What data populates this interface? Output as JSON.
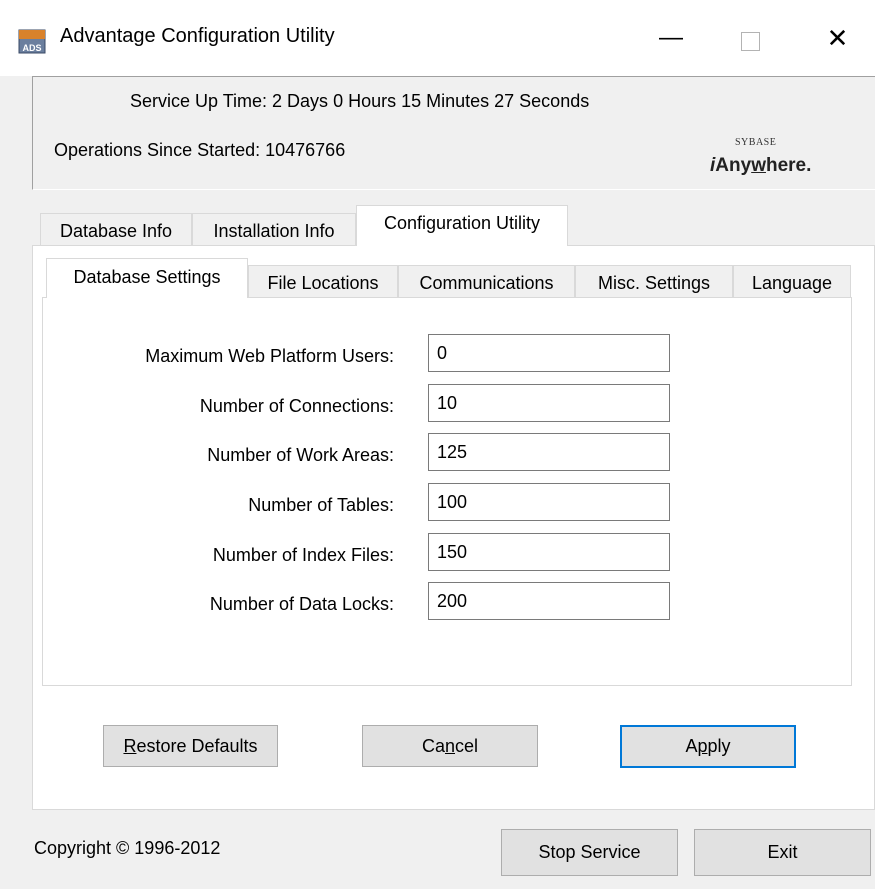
{
  "window": {
    "title": "Advantage Configuration Utility",
    "icon_label": "ADS",
    "minimize_glyph": "—",
    "close_glyph": "✕"
  },
  "status": {
    "uptime": "Service Up Time: 2 Days 0 Hours 15 Minutes 27 Seconds",
    "operations": "Operations Since Started: 10476766",
    "logo_top": "SYBASE",
    "logo_i": "i",
    "logo_any": "Any",
    "logo_w": "w",
    "logo_here": "here",
    "logo_dot": "."
  },
  "outer_tabs": [
    {
      "label": "Database Info"
    },
    {
      "label": "Installation Info"
    },
    {
      "label": "Configuration Utility",
      "active": true
    }
  ],
  "inner_tabs": [
    {
      "label": "Database Settings",
      "active": true
    },
    {
      "label": "File Locations"
    },
    {
      "label": "Communications"
    },
    {
      "label": "Misc. Settings"
    },
    {
      "label": "Language"
    }
  ],
  "settings": [
    {
      "label": "Maximum Web Platform Users:",
      "value": "0"
    },
    {
      "label": "Number of Connections:",
      "value": "10"
    },
    {
      "label": "Number of Work Areas:",
      "value": "125"
    },
    {
      "label": "Number of Tables:",
      "value": "100"
    },
    {
      "label": "Number of Index Files:",
      "value": "150"
    },
    {
      "label": "Number of Data Locks:",
      "value": "200"
    }
  ],
  "buttons": {
    "restore_prefix": "",
    "restore_ul": "R",
    "restore_rest": "estore Defaults",
    "cancel_pre": "Ca",
    "cancel_ul": "n",
    "cancel_rest": "cel",
    "apply_pre": "A",
    "apply_ul": "p",
    "apply_rest": "ply",
    "stop": "Stop Service",
    "exit": "Exit"
  },
  "footer": {
    "copyright": "Copyright © 1996-2012"
  },
  "colors": {
    "focus_border": "#0078d7",
    "window_bg": "#f0f0f0"
  }
}
